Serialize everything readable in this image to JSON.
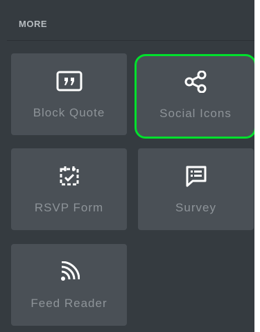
{
  "section": {
    "title": "MORE"
  },
  "tiles": [
    {
      "label": "Block Quote",
      "icon": "quote-icon",
      "selected": false
    },
    {
      "label": "Social Icons",
      "icon": "share-icon",
      "selected": true
    },
    {
      "label": "RSVP Form",
      "icon": "rsvp-icon",
      "selected": false
    },
    {
      "label": "Survey",
      "icon": "survey-icon",
      "selected": false
    },
    {
      "label": "Feed Reader",
      "icon": "rss-icon",
      "selected": false
    }
  ],
  "colors": {
    "panel": "#353b40",
    "tile": "#4a5056",
    "icon": "#ffffff",
    "label": "#8e9499",
    "selection": "#00e02c"
  }
}
